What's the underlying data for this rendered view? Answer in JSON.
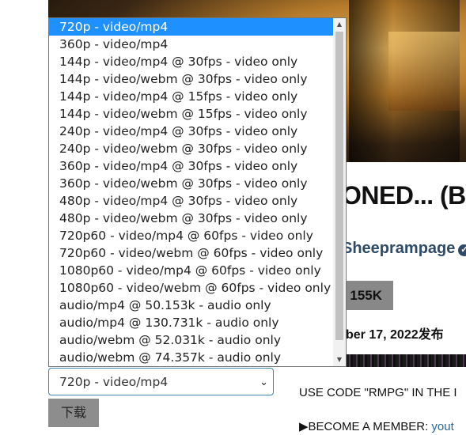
{
  "background": {
    "title_fragment": "ONED... (B",
    "channel": "Sheeprampage",
    "verified_icon": "check-icon",
    "subscribe_count": "155K",
    "date_fragment": "ber 17, 2022发布",
    "description_line1": "USE CODE \"RMPG\" IN THE I",
    "description_line2_prefix": "▶BECOME A MEMBER: ",
    "description_line2_link": "yout"
  },
  "format_select": {
    "selected_value": "720p - video/mp4",
    "options": [
      "720p - video/mp4",
      "360p - video/mp4",
      "144p - video/mp4 @ 30fps - video only",
      "144p - video/webm @ 30fps - video only",
      "144p - video/mp4 @ 15fps - video only",
      "144p - video/webm @ 15fps - video only",
      "240p - video/mp4 @ 30fps - video only",
      "240p - video/webm @ 30fps - video only",
      "360p - video/mp4 @ 30fps - video only",
      "360p - video/webm @ 30fps - video only",
      "480p - video/mp4 @ 30fps - video only",
      "480p - video/webm @ 30fps - video only",
      "720p60 - video/mp4 @ 60fps - video only",
      "720p60 - video/webm @ 60fps - video only",
      "1080p60 - video/mp4 @ 60fps - video only",
      "1080p60 - video/webm @ 60fps - video only",
      "audio/mp4 @ 50.153k - audio only",
      "audio/mp4 @ 130.731k - audio only",
      "audio/webm @ 52.031k - audio only",
      "audio/webm @ 74.357k - audio only"
    ]
  },
  "download_button": {
    "label": "下载"
  },
  "colors": {
    "option_highlight": "#1e90ff",
    "channel_text": "#2f4a66",
    "select_border": "#3b87ae"
  }
}
